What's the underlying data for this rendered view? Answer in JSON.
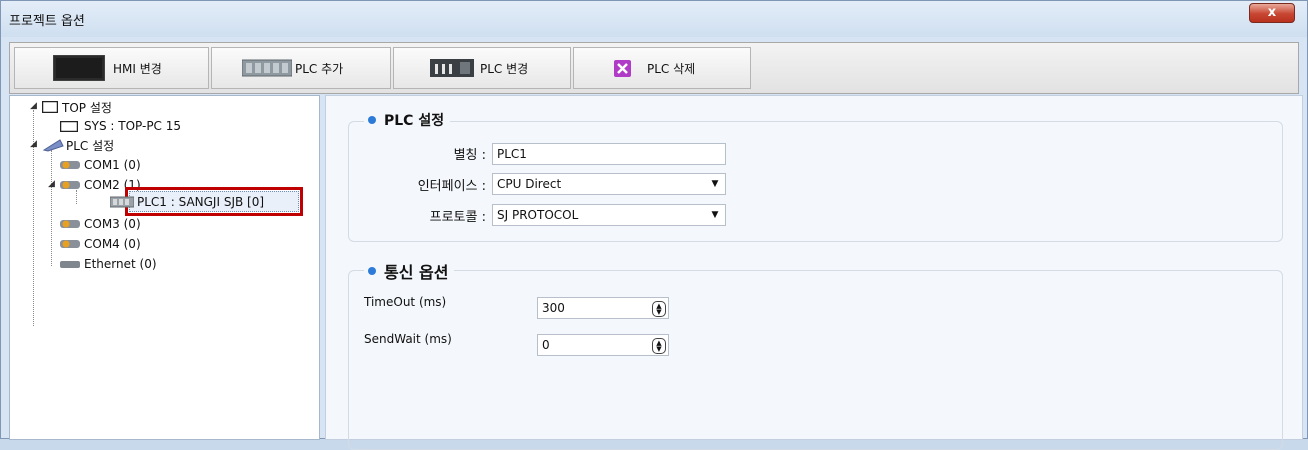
{
  "window": {
    "title": "프로젝트 옵션",
    "close_label": "x"
  },
  "toolbar": {
    "hmi_change": "HMI 변경",
    "plc_add": "PLC 추가",
    "plc_change": "PLC 변경",
    "plc_delete": "PLC 삭제"
  },
  "tree": {
    "top_setting": "TOP 설정",
    "sys": "SYS : TOP-PC 15",
    "plc_setting": "PLC 설정",
    "com1": "COM1 (0)",
    "com2": "COM2 (1)",
    "plc1": "PLC1 : SANGJI SJB [0]",
    "com3": "COM3 (0)",
    "com4": "COM4 (0)",
    "ethernet": "Ethernet (0)"
  },
  "plc_settings": {
    "title": "PLC 설정",
    "alias_label": "별칭 :",
    "alias_value": "PLC1",
    "interface_label": "인터페이스 :",
    "interface_value": "CPU Direct",
    "protocol_label": "프로토콜 :",
    "protocol_value": "SJ PROTOCOL"
  },
  "comm_options": {
    "title": "통신 옵션",
    "timeout_label": "TimeOut (ms)",
    "timeout_value": "300",
    "sendwait_label": "SendWait (ms)",
    "sendwait_value": "0"
  },
  "colors": {
    "highlight": "#c00000",
    "accent": "#2d7bd8",
    "window_bg": "#d6e4f3"
  }
}
